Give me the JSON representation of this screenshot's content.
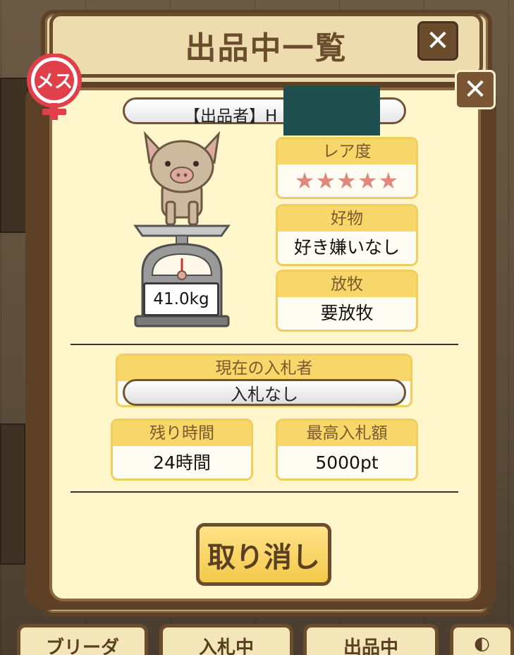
{
  "outer": {
    "title": "出品中一覧",
    "close_label": "✕"
  },
  "modal": {
    "close_label": "✕",
    "gender_badge": "メス",
    "seller_label": "【出品者】H",
    "weight": "41.0kg",
    "rarity": {
      "label": "レア度",
      "stars": "★★★★★",
      "value": 5
    },
    "favorite_food": {
      "label": "好物",
      "value": "好き嫌いなし"
    },
    "grazing": {
      "label": "放牧",
      "value": "要放牧"
    },
    "current_bidder": {
      "label": "現在の入札者",
      "value": "入札なし"
    },
    "time_left": {
      "label": "残り時間",
      "value": "24時間"
    },
    "top_bid": {
      "label": "最高入札額",
      "value": "5000pt"
    },
    "cancel_label": "取り消し"
  },
  "tabs": [
    {
      "label": "ブリーダ"
    },
    {
      "label": "入札中"
    },
    {
      "label": "出品中"
    }
  ],
  "colors": {
    "frame_brown": "#5e4026",
    "panel_cream": "#fff6cc",
    "header_yellow": "#f7d66a",
    "star_pink": "#e0887c",
    "badge_red": "#e0404a"
  }
}
